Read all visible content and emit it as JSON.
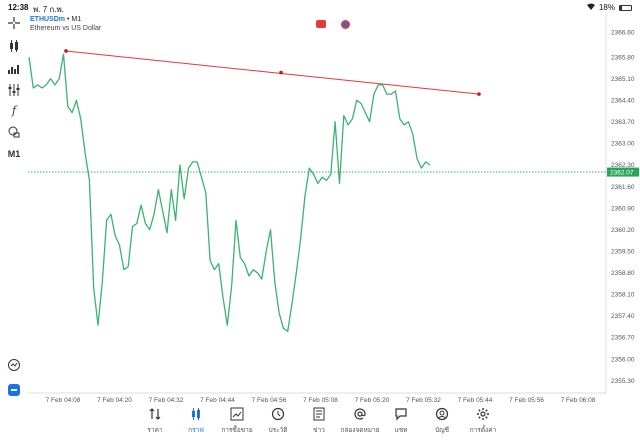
{
  "status_bar": {
    "time": "12:38",
    "date": "พ. 7 ก.พ.",
    "battery": "18%"
  },
  "chart_header": {
    "symbol": "ETHUSDm",
    "timeframe": "• M1",
    "description": "Ethereum vs US Dollar"
  },
  "toolbar": {
    "timeframe_label": "M1",
    "icons": [
      "crosshair-icon",
      "candles-icon",
      "indicators-icon",
      "settings-sliders-icon",
      "function-icon",
      "objects-icon",
      "zoom-icon",
      "logo-icon"
    ]
  },
  "chart_data": {
    "type": "line",
    "series": [
      {
        "values": [
          2365.8,
          2364.8,
          2364.9,
          2364.8,
          2364.9,
          2365.1,
          2364.9,
          2365.1,
          2365.9,
          2364.2,
          2364.0,
          2364.4,
          2363.8,
          2362.7,
          2361.8,
          2358.3,
          2357.1,
          2358.5,
          2360.5,
          2360.7,
          2360.0,
          2359.7,
          2358.9,
          2359.0,
          2360.3,
          2360.4,
          2361.0,
          2360.4,
          2360.2,
          2360.7,
          2361.5,
          2360.8,
          2360.1,
          2361.5,
          2360.5,
          2362.3,
          2361.2,
          2362.2,
          2362.4,
          2362.4,
          2361.9,
          2361.4,
          2359.2,
          2358.9,
          2359.1,
          2358.0,
          2357.1,
          2358.4,
          2360.5,
          2359.3,
          2359.1,
          2358.7,
          2358.9,
          2358.8,
          2358.6,
          2359.5,
          2360.2,
          2358.5,
          2357.5,
          2357.0,
          2356.9,
          2357.8,
          2358.8,
          2359.9,
          2361.3,
          2362.2,
          2362.0,
          2361.7,
          2361.9,
          2361.8,
          2362.0,
          2363.7,
          2361.7,
          2363.9,
          2363.6,
          2363.8,
          2364.4,
          2364.3,
          2364.0,
          2363.7,
          2364.6,
          2364.9,
          2364.9,
          2364.6,
          2364.6,
          2364.7,
          2363.8,
          2363.6,
          2363.7,
          2363.3,
          2362.5,
          2362.2,
          2362.4,
          2362.3
        ]
      }
    ],
    "trendline": {
      "from": [
        "7 Feb 04:08",
        2366.0
      ],
      "mid": [
        "7 Feb 04:56",
        2365.3
      ],
      "to": [
        "7 Feb 05:44",
        2364.6
      ]
    },
    "current_price": 2362.07,
    "price_ticks": [
      "2366.60",
      "2365.80",
      "2365.10",
      "2364.40",
      "2363.70",
      "2363.00",
      "2362.30",
      "2361.60",
      "2360.90",
      "2360.20",
      "2359.50",
      "2358.80",
      "2358.10",
      "2357.40",
      "2356.70",
      "2356.00",
      "2355.30"
    ],
    "price_tick_values": [
      2366.6,
      2365.8,
      2365.1,
      2364.4,
      2363.7,
      2363.0,
      2362.3,
      2361.6,
      2360.9,
      2360.2,
      2359.5,
      2358.8,
      2358.1,
      2357.4,
      2356.7,
      2356.0,
      2355.3
    ],
    "time_ticks": [
      "7 Feb 04:08",
      "7 Feb 04:20",
      "7 Feb 04:32",
      "7 Feb 04:44",
      "7 Feb 04:56",
      "7 Feb 05:08",
      "7 Feb 05:20",
      "7 Feb 05:32",
      "7 Feb 05:44",
      "7 Feb 05:56",
      "7 Feb 06:08"
    ],
    "ylim": [
      2354.9,
      2367.2
    ],
    "grid": false,
    "line_color": "#3cb371",
    "trendline_color": "#e53935",
    "price_line_color": "#26a65b"
  },
  "bottom_nav": [
    {
      "name": "quotes",
      "label": "ราคา",
      "icon": "sort-arrows-icon",
      "active": false
    },
    {
      "name": "chart",
      "label": "กราฟ",
      "icon": "candles-icon",
      "active": true
    },
    {
      "name": "trade",
      "label": "การซื้อขาย",
      "icon": "trend-chart-icon",
      "active": false
    },
    {
      "name": "history",
      "label": "ประวัติ",
      "icon": "clock-history-icon",
      "active": false
    },
    {
      "name": "news",
      "label": "ข่าว",
      "icon": "newspaper-icon",
      "active": false
    },
    {
      "name": "mailbox",
      "label": "กล่องจดหมาย",
      "icon": "at-sign-icon",
      "active": false
    },
    {
      "name": "chat",
      "label": "แชท",
      "icon": "chat-bubble-icon",
      "active": false
    },
    {
      "name": "account",
      "label": "บัญชี",
      "icon": "user-icon",
      "active": false
    },
    {
      "name": "settings",
      "label": "การตั้งค่า",
      "icon": "gear-icon",
      "active": false
    }
  ],
  "colors": {
    "accent": "#1a73e8",
    "up_line": "#3cb371",
    "trendline": "#e53935"
  }
}
